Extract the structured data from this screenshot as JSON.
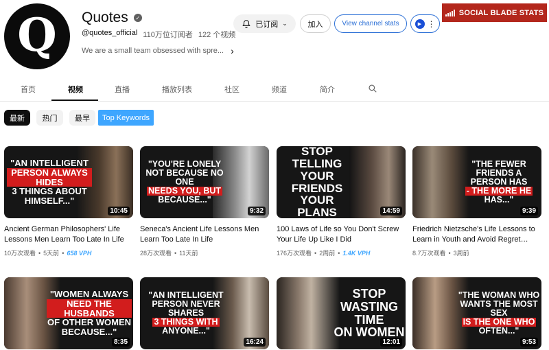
{
  "channel": {
    "avatar_letter": "Q",
    "name": "Quotes",
    "handle": "@quotes_official",
    "subscribers": "110万位订阅者",
    "videos_count": "122 个视频",
    "description": "We are a small team obsessed with spre...",
    "subscribed_label": "已订阅",
    "join_label": "加入",
    "stats_label": "View channel stats"
  },
  "social_blade": {
    "label": "SOCIAL BLADE STATS",
    "color": "#b3271c"
  },
  "tabs": [
    {
      "label": "首页"
    },
    {
      "label": "视频"
    },
    {
      "label": "直播"
    },
    {
      "label": "播放列表"
    },
    {
      "label": "社区"
    },
    {
      "label": "频道"
    },
    {
      "label": "简介"
    }
  ],
  "chips": [
    {
      "label": "最新"
    },
    {
      "label": "热门"
    },
    {
      "label": "最早"
    },
    {
      "label": "Top Keywords"
    }
  ],
  "videos": [
    {
      "thumb_lines": [
        "\"An intelligent",
        "person always hides",
        "3 things about",
        "himself...\""
      ],
      "duration": "10:45",
      "title": "Ancient German Philosophers' Life Lessons Men Learn Too Late In Life",
      "views": "10万次观看",
      "age": "5天前",
      "vph": "658 VPH"
    },
    {
      "thumb_lines": [
        "\"You're lonely",
        "not because no one",
        "needs you, but",
        "because...\""
      ],
      "duration": "9:32",
      "title": "Seneca's Ancient Life Lessons Men Learn Too Late In Life",
      "views": "28万次观看",
      "age": "11天前",
      "vph": ""
    },
    {
      "thumb_lines": [
        "Stop telling",
        "your friends",
        "your plans"
      ],
      "duration": "14:59",
      "title": "100 Laws of Life so You Don't Screw Your Life Up Like I Did",
      "views": "176万次观看",
      "age": "2周前",
      "vph": "1.4K VPH"
    },
    {
      "thumb_lines": [
        "\"The fewer",
        "friends a person has",
        "- the more he",
        "has...\""
      ],
      "duration": "9:39",
      "title": "Friedrich Nietzsche's Life Lessons to Learn in Youth and Avoid Regret…",
      "views": "8.7万次观看",
      "age": "3周前",
      "vph": ""
    },
    {
      "thumb_lines": [
        "\"Women always",
        "need the husbands",
        "of other women",
        "because...\""
      ],
      "duration": "8:35",
      "title": "",
      "views": "",
      "age": "",
      "vph": ""
    },
    {
      "thumb_lines": [
        "\"An intelligent",
        "person never shares",
        "3 things with",
        "anyone...\""
      ],
      "duration": "16:24",
      "title": "",
      "views": "",
      "age": "",
      "vph": ""
    },
    {
      "thumb_lines": [
        "Stop",
        "wasting time",
        "on women"
      ],
      "duration": "12:01",
      "title": "",
      "views": "",
      "age": "",
      "vph": ""
    },
    {
      "thumb_lines": [
        "\"The woman who",
        "wants the most sex",
        "is the one who",
        "often...\""
      ],
      "duration": "9:53",
      "title": "",
      "views": "",
      "age": "",
      "vph": ""
    }
  ],
  "colors": {
    "accent_blue": "#3ea6ff",
    "link_blue": "#2b6fd6",
    "badge_red": "#d21d1d"
  }
}
